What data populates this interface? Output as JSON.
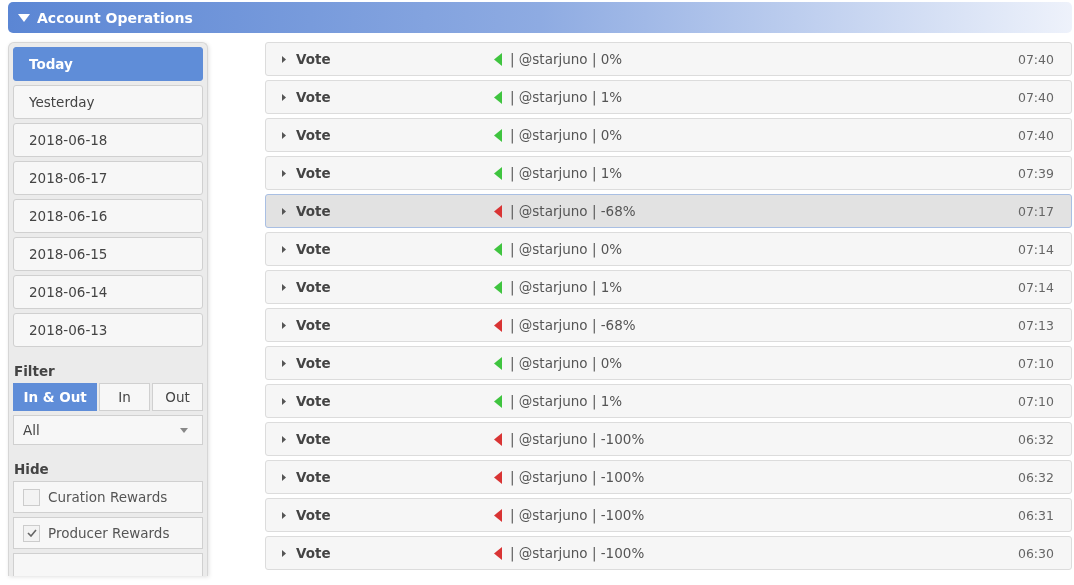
{
  "panel": {
    "title": "Account Operations",
    "expanded": true
  },
  "dates": [
    {
      "label": "Today",
      "selected": true
    },
    {
      "label": "Yesterday",
      "selected": false
    },
    {
      "label": "2018-06-18",
      "selected": false
    },
    {
      "label": "2018-06-17",
      "selected": false
    },
    {
      "label": "2018-06-16",
      "selected": false
    },
    {
      "label": "2018-06-15",
      "selected": false
    },
    {
      "label": "2018-06-14",
      "selected": false
    },
    {
      "label": "2018-06-13",
      "selected": false
    }
  ],
  "filter": {
    "title": "Filter",
    "options": [
      {
        "label": "In & Out",
        "selected": true
      },
      {
        "label": "In",
        "selected": false
      },
      {
        "label": "Out",
        "selected": false
      }
    ],
    "select": {
      "value": "All"
    }
  },
  "hide": {
    "title": "Hide",
    "items": [
      {
        "label": "Curation Rewards",
        "checked": false
      },
      {
        "label": "Producer Rewards",
        "checked": true
      }
    ]
  },
  "operations": [
    {
      "type": "Vote",
      "color": "#3fc43f",
      "detail": "| @starjuno | 0%",
      "time": "07:40",
      "selected": false
    },
    {
      "type": "Vote",
      "color": "#3fc43f",
      "detail": "| @starjuno | 1%",
      "time": "07:40",
      "selected": false
    },
    {
      "type": "Vote",
      "color": "#3fc43f",
      "detail": "| @starjuno | 0%",
      "time": "07:40",
      "selected": false
    },
    {
      "type": "Vote",
      "color": "#3fc43f",
      "detail": "| @starjuno | 1%",
      "time": "07:39",
      "selected": false
    },
    {
      "type": "Vote",
      "color": "#d93434",
      "detail": "| @starjuno | -68%",
      "time": "07:17",
      "selected": true
    },
    {
      "type": "Vote",
      "color": "#3fc43f",
      "detail": "| @starjuno | 0%",
      "time": "07:14",
      "selected": false
    },
    {
      "type": "Vote",
      "color": "#3fc43f",
      "detail": "| @starjuno | 1%",
      "time": "07:14",
      "selected": false
    },
    {
      "type": "Vote",
      "color": "#d93434",
      "detail": "| @starjuno | -68%",
      "time": "07:13",
      "selected": false
    },
    {
      "type": "Vote",
      "color": "#3fc43f",
      "detail": "| @starjuno | 0%",
      "time": "07:10",
      "selected": false
    },
    {
      "type": "Vote",
      "color": "#3fc43f",
      "detail": "| @starjuno | 1%",
      "time": "07:10",
      "selected": false
    },
    {
      "type": "Vote",
      "color": "#d93434",
      "detail": "| @starjuno | -100%",
      "time": "06:32",
      "selected": false
    },
    {
      "type": "Vote",
      "color": "#d93434",
      "detail": "| @starjuno | -100%",
      "time": "06:32",
      "selected": false
    },
    {
      "type": "Vote",
      "color": "#d93434",
      "detail": "| @starjuno | -100%",
      "time": "06:31",
      "selected": false
    },
    {
      "type": "Vote",
      "color": "#d93434",
      "detail": "| @starjuno | -100%",
      "time": "06:30",
      "selected": false
    }
  ]
}
